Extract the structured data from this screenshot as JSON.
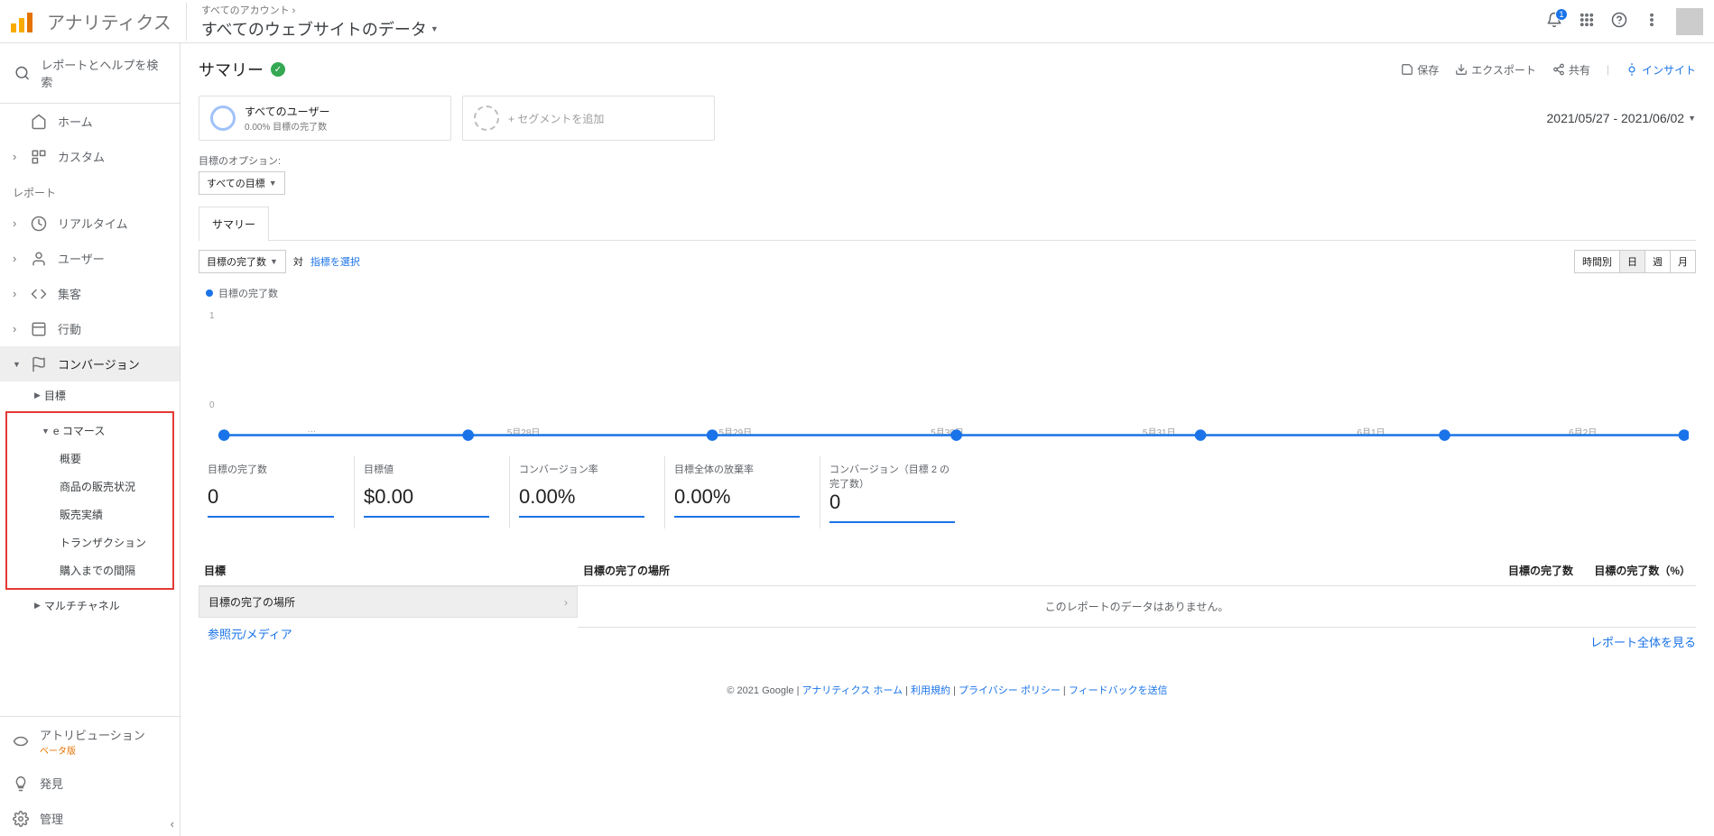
{
  "header": {
    "app_title": "アナリティクス",
    "accounts_label": "すべてのアカウント ›",
    "view_name": "すべてのウェブサイトのデータ",
    "bell_count": "1"
  },
  "sidebar": {
    "search_placeholder": "レポートとヘルプを検索",
    "home": "ホーム",
    "custom": "カスタム",
    "reports_label": "レポート",
    "realtime": "リアルタイム",
    "audience": "ユーザー",
    "acquisition": "集客",
    "behavior": "行動",
    "conversion": "コンバージョン",
    "goals": "目標",
    "ecommerce_head": "e コマース",
    "ecommerce": {
      "overview": "概要",
      "product_perf": "商品の販売状況",
      "sales_perf": "販売実績",
      "transactions": "トランザクション",
      "time_to_purchase": "購入までの間隔"
    },
    "multichannel": "マルチチャネル",
    "attribution": "アトリビューション",
    "attribution_badge": "ベータ版",
    "discover": "発見",
    "admin": "管理"
  },
  "report": {
    "title": "サマリー",
    "save": "保存",
    "export": "エクスポート",
    "share": "共有",
    "insight": "インサイト",
    "segment_all_users": "すべてのユーザー",
    "segment_sub": "0.00% 目標の完了数",
    "segment_add": "+ セグメントを追加",
    "date_range": "2021/05/27 - 2021/06/02",
    "goal_option_label": "目標のオプション:",
    "goal_all": "すべての目標",
    "tab_summary": "サマリー",
    "metric_primary": "目標の完了数",
    "vs": "対",
    "metric_select": "指標を選択",
    "time_hour": "時間別",
    "time_day": "日",
    "time_week": "週",
    "time_month": "月",
    "legend": "目標の完了数",
    "ytick_1": "1",
    "ytick_0": "0"
  },
  "chart_data": {
    "type": "line",
    "categories": [
      "…",
      "5月28日",
      "5月29日",
      "5月30日",
      "5月31日",
      "6月1日",
      "6月2日"
    ],
    "values": [
      0,
      0,
      0,
      0,
      0,
      0,
      0
    ],
    "ylim": [
      0,
      1
    ],
    "title": "目標の完了数"
  },
  "kpis": [
    {
      "label": "目標の完了数",
      "value": "0"
    },
    {
      "label": "目標値",
      "value": "$0.00"
    },
    {
      "label": "コンバージョン率",
      "value": "0.00%"
    },
    {
      "label": "目標全体の放棄率",
      "value": "0.00%"
    },
    {
      "label": "コンバージョン（目標 2 の完了数）",
      "value": "0"
    }
  ],
  "table": {
    "left_header": "目標",
    "row_selected": "目標の完了の場所",
    "row_source": "参照元/メディア",
    "col_place": "目標の完了の場所",
    "col_count": "目標の完了数",
    "col_pct": "目標の完了数（%）",
    "nodata": "このレポートのデータはありません。",
    "full_report": "レポート全体を見る"
  },
  "footer": {
    "copyright": "© 2021 Google",
    "home": "アナリティクス ホーム",
    "terms": "利用規約",
    "privacy": "プライバシー ポリシー",
    "feedback": "フィードバックを送信"
  }
}
